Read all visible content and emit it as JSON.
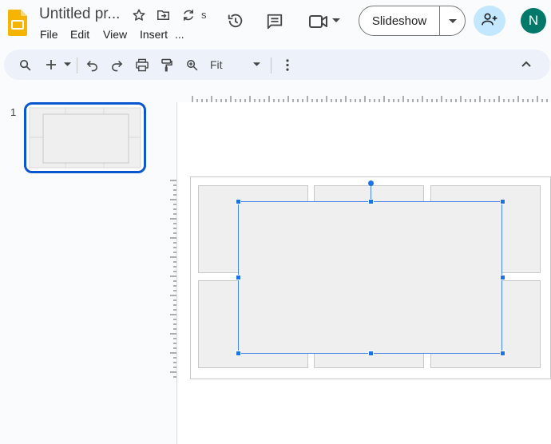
{
  "app": {
    "doc_title": "Untitled pr...",
    "cut_label": "s",
    "menus": [
      "File",
      "Edit",
      "View",
      "Insert",
      "..."
    ]
  },
  "header": {
    "slideshow_label": "Slideshow",
    "avatar_initial": "N"
  },
  "toolbar": {
    "zoom_value": "Fit"
  },
  "filmstrip": {
    "slide_number": "1"
  },
  "colors": {
    "accent": "#0b57d0",
    "selection": "#4a86e8",
    "share_bg": "#c2e7ff",
    "avatar_bg": "#00796b",
    "toolbar_bg": "#edf2fa"
  },
  "icons": [
    "slides-logo-icon",
    "star-icon",
    "move-folder-icon",
    "sync-icon",
    "history-icon",
    "comment-icon",
    "video-call-icon",
    "chevron-down-icon",
    "add-person-icon",
    "search-icon",
    "plus-icon",
    "undo-icon",
    "redo-icon",
    "print-icon",
    "paint-format-icon",
    "zoom-icon",
    "more-vertical-icon",
    "chevron-up-icon"
  ]
}
